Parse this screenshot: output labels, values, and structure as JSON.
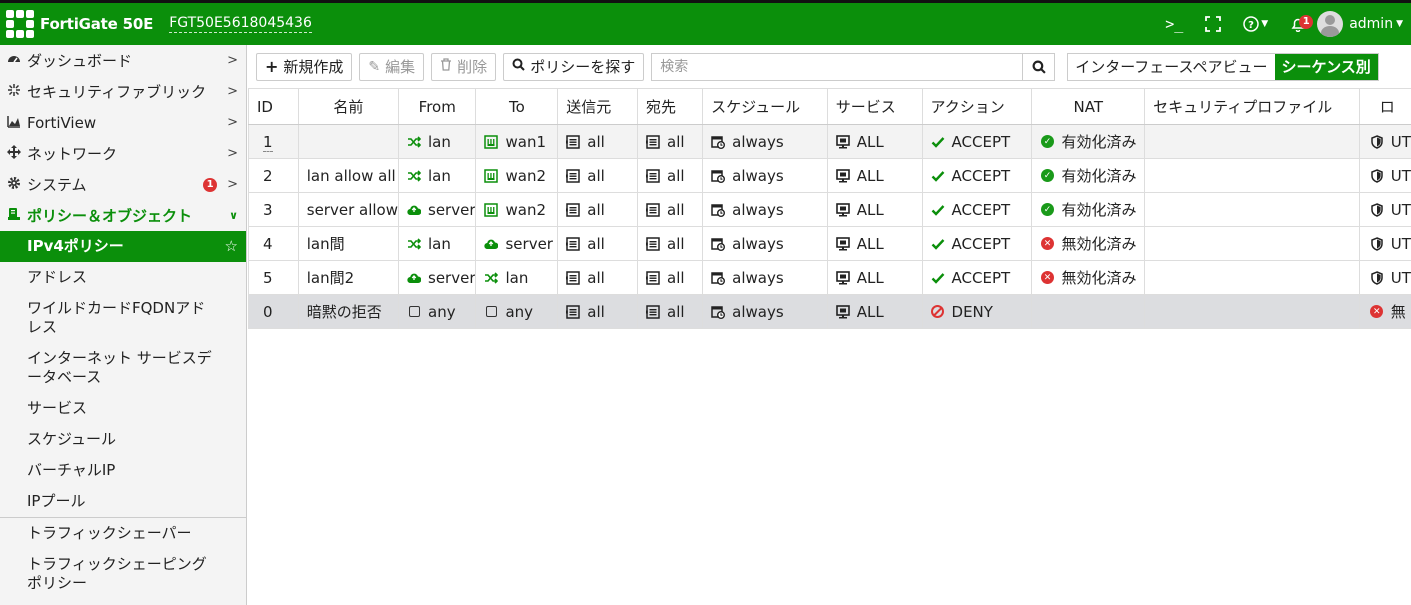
{
  "header": {
    "product": "FortiGate 50E",
    "serial": "FGT50E5618045436",
    "notifications_count": "1",
    "user": "admin"
  },
  "sidebar": {
    "items": [
      {
        "label": "ダッシュボード",
        "icon": "dashboard-icon"
      },
      {
        "label": "セキュリティファブリック",
        "icon": "fabric-icon"
      },
      {
        "label": "FortiView",
        "icon": "chart-icon"
      },
      {
        "label": "ネットワーク",
        "icon": "network-icon"
      },
      {
        "label": "システム",
        "icon": "gear-icon",
        "badge": "1"
      },
      {
        "label": "ポリシー＆オブジェクト",
        "icon": "policy-icon"
      }
    ],
    "sub_items": [
      {
        "label": "IPv4ポリシー"
      },
      {
        "label": "アドレス"
      },
      {
        "label": "ワイルドカードFQDNアドレス"
      },
      {
        "label": "インターネット サービスデータベース"
      },
      {
        "label": "サービス"
      },
      {
        "label": "スケジュール"
      },
      {
        "label": "バーチャルIP"
      },
      {
        "label": "IPプール"
      },
      {
        "label": "トラフィックシェーパー"
      },
      {
        "label": "トラフィックシェーピングポリシー"
      }
    ]
  },
  "toolbar": {
    "create_label": "新規作成",
    "edit_label": "編集",
    "delete_label": "削除",
    "find_label": "ポリシーを探す",
    "search_placeholder": "検索",
    "view_interface_pair": "インターフェースペアビュー",
    "view_sequence": "シーケンス別"
  },
  "table": {
    "columns": [
      "ID",
      "名前",
      "From",
      "To",
      "送信元",
      "宛先",
      "スケジュール",
      "サービス",
      "アクション",
      "NAT",
      "セキュリティプロファイル",
      "ロ"
    ],
    "rows": [
      {
        "id": "1",
        "name": "",
        "from": "lan",
        "from_icon": "switch-icon",
        "to": "wan1",
        "to_icon": "port-icon",
        "src": "all",
        "dst": "all",
        "schedule": "always",
        "service": "ALL",
        "action": "ACCEPT",
        "nat": "有効化済み",
        "nat_status": "enabled",
        "log": "UT"
      },
      {
        "id": "2",
        "name": "lan allow all",
        "from": "lan",
        "from_icon": "switch-icon",
        "to": "wan2",
        "to_icon": "port-icon",
        "src": "all",
        "dst": "all",
        "schedule": "always",
        "service": "ALL",
        "action": "ACCEPT",
        "nat": "有効化済み",
        "nat_status": "enabled",
        "log": "UT"
      },
      {
        "id": "3",
        "name": "server allow",
        "from": "server",
        "from_icon": "cloud-icon",
        "to": "wan2",
        "to_icon": "port-icon",
        "src": "all",
        "dst": "all",
        "schedule": "always",
        "service": "ALL",
        "action": "ACCEPT",
        "nat": "有効化済み",
        "nat_status": "enabled",
        "log": "UT"
      },
      {
        "id": "4",
        "name": "lan間",
        "from": "lan",
        "from_icon": "switch-icon",
        "to": "server",
        "to_icon": "cloud-icon",
        "src": "all",
        "dst": "all",
        "schedule": "always",
        "service": "ALL",
        "action": "ACCEPT",
        "nat": "無効化済み",
        "nat_status": "disabled",
        "log": "UT"
      },
      {
        "id": "5",
        "name": "lan間2",
        "from": "server",
        "from_icon": "cloud-icon",
        "to": "lan",
        "to_icon": "switch-icon",
        "src": "all",
        "dst": "all",
        "schedule": "always",
        "service": "ALL",
        "action": "ACCEPT",
        "nat": "無効化済み",
        "nat_status": "disabled",
        "log": "UT"
      },
      {
        "id": "0",
        "name": "暗黙の拒否",
        "from": "any",
        "from_icon": "box-icon",
        "to": "any",
        "to_icon": "box-icon",
        "src": "all",
        "dst": "all",
        "schedule": "always",
        "service": "ALL",
        "action": "DENY",
        "nat": "",
        "nat_status": "",
        "log": "無"
      }
    ]
  },
  "colors": {
    "brand": "#0b8f0b",
    "badge": "#dd3333"
  }
}
